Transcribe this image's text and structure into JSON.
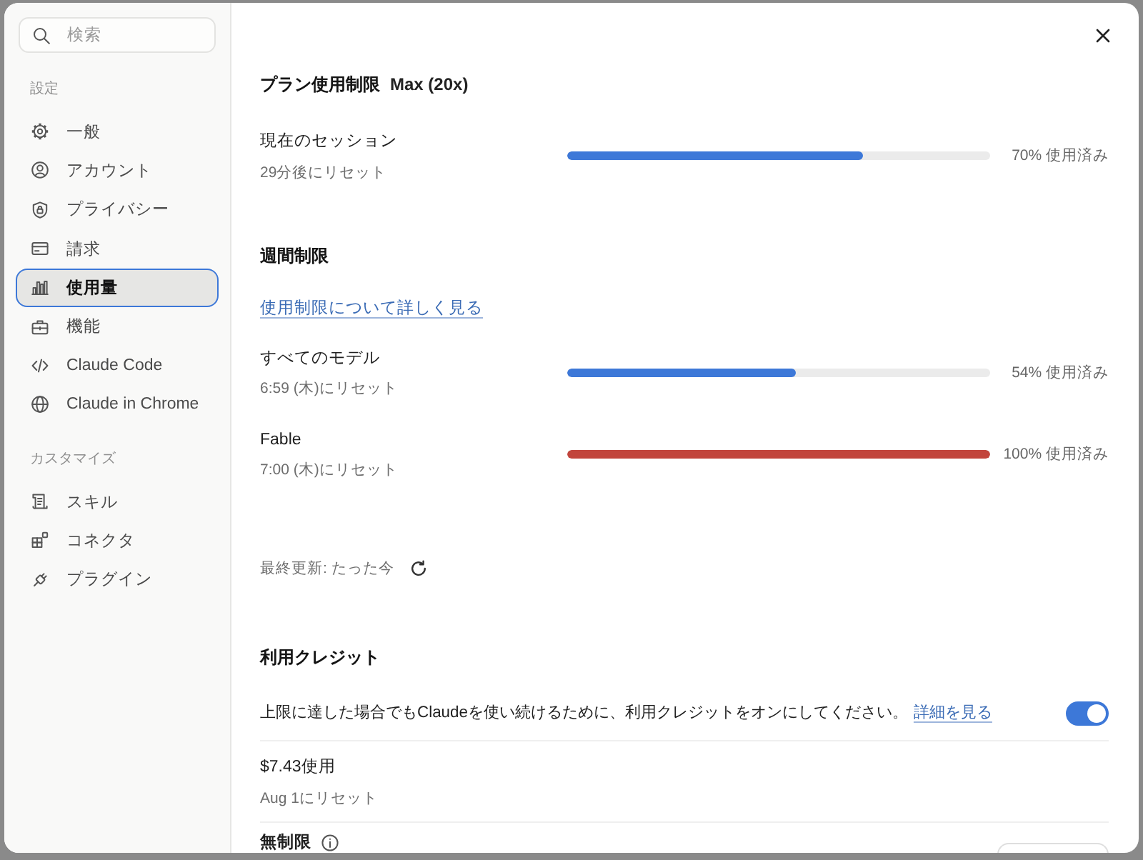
{
  "sidebar": {
    "search": {
      "placeholder": "検索"
    },
    "sections": [
      {
        "label": "設定",
        "items": [
          {
            "label": "一般",
            "selected": false
          },
          {
            "label": "アカウント",
            "selected": false
          },
          {
            "label": "プライバシー",
            "selected": false
          },
          {
            "label": "請求",
            "selected": false
          },
          {
            "label": "使用量",
            "selected": true
          },
          {
            "label": "機能",
            "selected": false
          },
          {
            "label": "Claude Code",
            "selected": false
          },
          {
            "label": "Claude in Chrome",
            "selected": false
          }
        ]
      },
      {
        "label": "カスタマイズ",
        "items": [
          {
            "label": "スキル",
            "selected": false
          },
          {
            "label": "コネクタ",
            "selected": false
          },
          {
            "label": "プラグイン",
            "selected": false
          }
        ]
      }
    ]
  },
  "plan_limits": {
    "title": "プラン使用制限",
    "plan": "Max (20x)",
    "meters": [
      {
        "name": "現在のセッション",
        "reset": "29分後にリセット",
        "level": 0.7,
        "color": "#3d78d8",
        "reading": "70% 使用済み"
      }
    ]
  },
  "weekly_limits": {
    "title": "週間制限",
    "link": "使用制限について詳しく見る",
    "meters": [
      {
        "name": "すべてのモデル",
        "reset": "6:59 (木)にリセット",
        "level": 0.54,
        "color": "#3d78d8",
        "reading": "54% 使用済み"
      },
      {
        "name": "Fable",
        "reset": "7:00 (木)にリセット",
        "level": 1,
        "color": "#c2453c",
        "reading": "100% 使用済み"
      }
    ]
  },
  "last_updated": "最終更新: たった今",
  "usage_credits": {
    "title": "利用クレジット",
    "description": "上限に達した場合でもClaudeを使い続けるために、利用クレジットをオンにしてください。",
    "link": "詳細を見る",
    "toggle": {
      "on": true
    },
    "spent": "$7.43使用",
    "reset": "Aug 1にリセット",
    "unlimited": "無制限"
  }
}
